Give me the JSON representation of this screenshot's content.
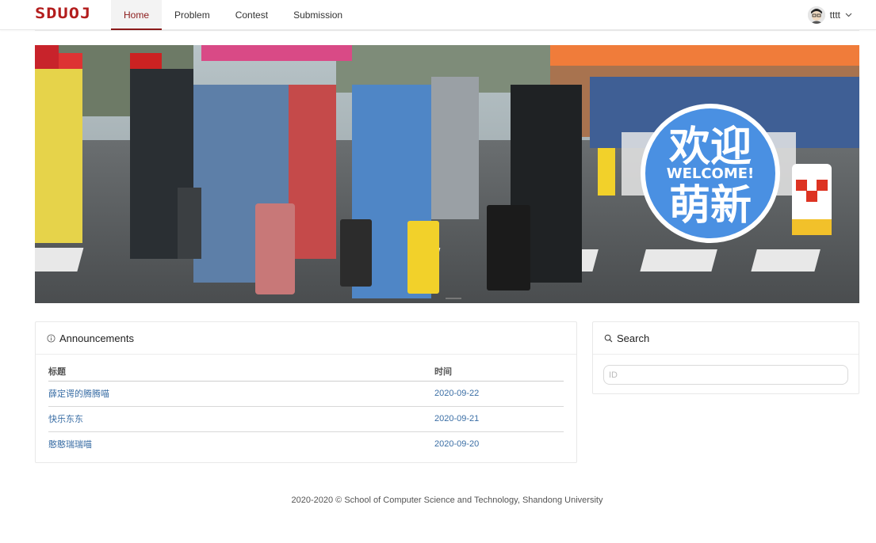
{
  "logo": {
    "text": "SDUOJ",
    "color": "#b31d1d"
  },
  "nav": {
    "items": [
      {
        "label": "Home",
        "active": true
      },
      {
        "label": "Problem",
        "active": false
      },
      {
        "label": "Contest",
        "active": false
      },
      {
        "label": "Submission",
        "active": false
      }
    ]
  },
  "user": {
    "name": "tttt",
    "avatar_icon": "avatar-icon",
    "menu_icon": "chevron-down-icon"
  },
  "banner": {
    "badge_line1": "欢迎",
    "badge_line2": "WELCOME!",
    "badge_line3": "萌新",
    "badge_color": "#4a90e2"
  },
  "announcements": {
    "title": "Announcements",
    "icon": "info-icon",
    "columns": [
      "标题",
      "时间"
    ],
    "rows": [
      {
        "title": "薛定谔的腾腾喵",
        "date": "2020-09-22"
      },
      {
        "title": "快乐东东",
        "date": "2020-09-21"
      },
      {
        "title": "憨憨瑞瑞喵",
        "date": "2020-09-20"
      }
    ]
  },
  "search": {
    "title": "Search",
    "icon": "search-icon",
    "placeholder": "ID"
  },
  "footer": {
    "text": "2020-2020 © School of Computer Science and Technology, Shandong University"
  },
  "colors": {
    "accent": "#8b1a1a",
    "link": "#3a6ea5"
  }
}
